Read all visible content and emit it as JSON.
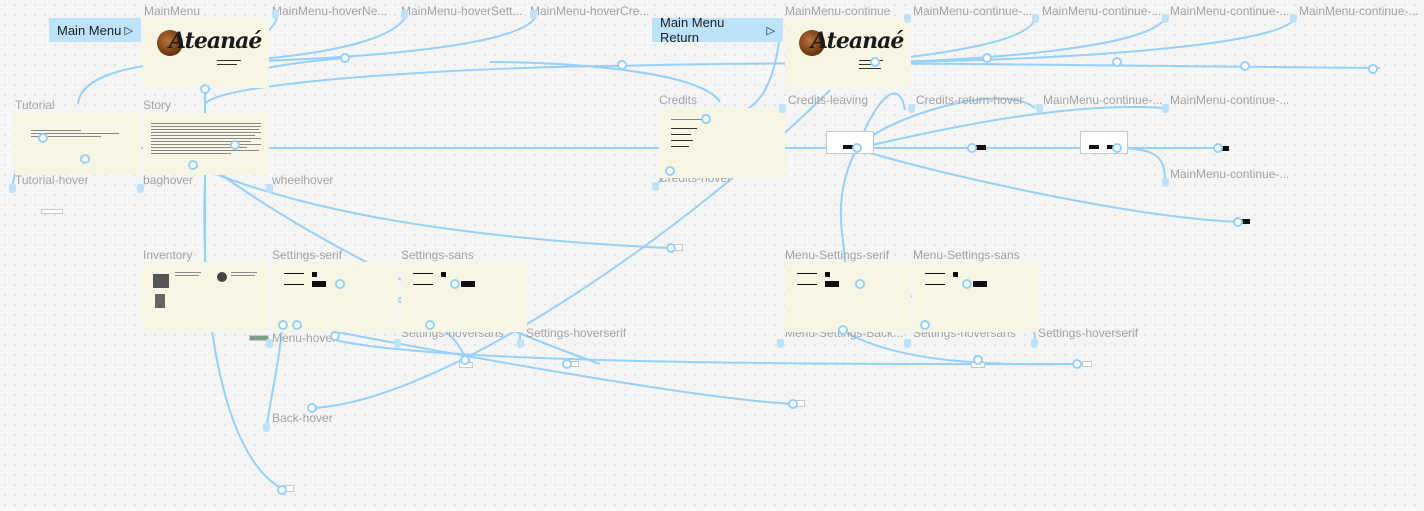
{
  "flow_starts": [
    {
      "id": "main-menu",
      "label": "Main Menu"
    },
    {
      "id": "main-menu-return",
      "label": "Main Menu Return"
    }
  ],
  "frames": {
    "mainmenu": "MainMenu",
    "hover_new": "MainMenu-hoverNe...",
    "hover_settings": "MainMenu-hoverSett...",
    "hover_credits": "MainMenu-hoverCre...",
    "continue": "MainMenu-continue",
    "continue_a": "MainMenu-continue-...",
    "continue_b": "MainMenu-continue-...",
    "continue_c": "MainMenu-continue-...",
    "continue_d": "MainMenu-continue-...",
    "tutorial": "Tutorial",
    "story": "Story",
    "credits": "Credits",
    "credits_leaving": "Credits-leaving",
    "credits_return_hover": "Credits-return-hover",
    "continue_e": "MainMenu-continue-...",
    "continue_f": "MainMenu-continue-...",
    "continue_g": "MainMenu-continue-...",
    "tutorial_hover": "Tutorial-hover",
    "bag_hover": "baghover",
    "wheel_hover": "wheelhover",
    "credits_hover": "Credits-hover",
    "inventory": "Inventory",
    "settings_serif": "Settings-serif",
    "settings_sans": "Settings-sans",
    "menu_settings_serif": "Menu-Settings-serif",
    "menu_settings_sans": "Menu-Settings-sans",
    "menu_hover": "Menu-hover",
    "settings_hoversans": "Settings-hoversans",
    "settings_hoverserif": "Settings-hoverserif",
    "menu_settings_back": "Menu-Settings-Back...",
    "settings_hoversans_2": "Settings-hoversans",
    "settings_hoverserif_2": "Settings-hoverserif",
    "back_hover": "Back-hover"
  },
  "logo": {
    "word": "Ateanaé"
  },
  "colors": {
    "canvas": "#f5f5f5",
    "connector": "#97d0f8",
    "flow_start": "#bde3fb",
    "frame": "#f7f6e4",
    "label": "#a3a3a3"
  }
}
